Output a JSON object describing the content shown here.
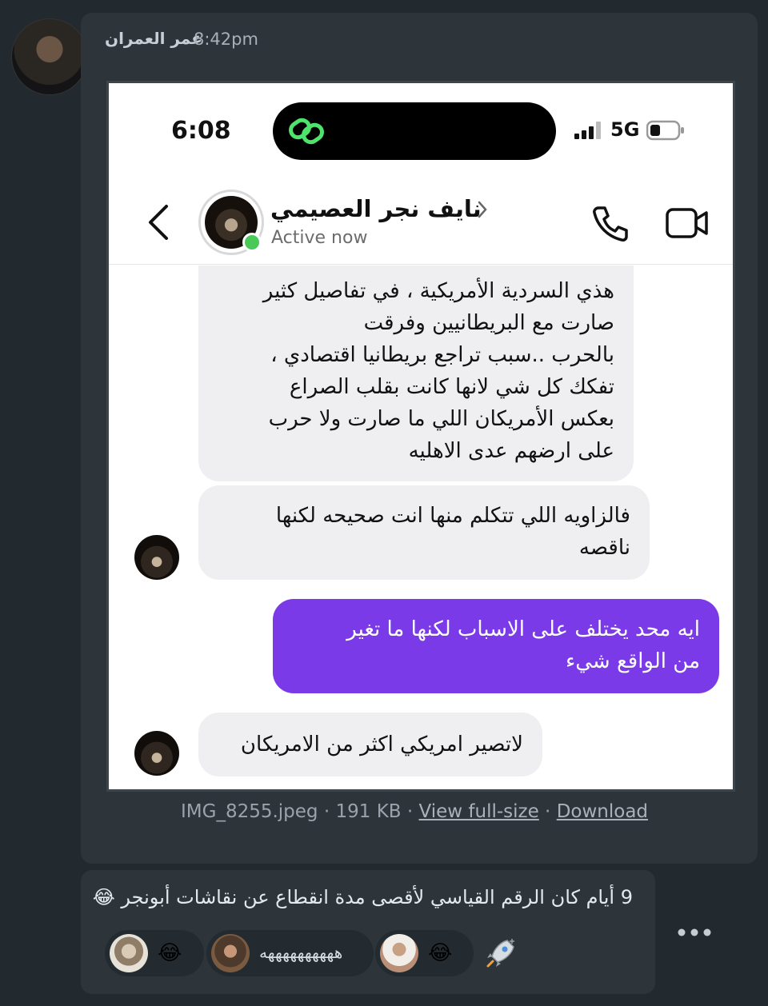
{
  "post": {
    "author": "عمر العمران",
    "time": "8:42pm"
  },
  "screenshot": {
    "status": {
      "time": "6:08",
      "network": "5G"
    },
    "contact": {
      "name": "نايف نجر العصيمي",
      "status": "Active now"
    },
    "messages": [
      {
        "direction": "in",
        "text": "هذي السردية الأمريكية ، في تفاصيل كثير\nصارت مع البريطانيين وفرقت\nبالحرب ..سبب تراجع بريطانيا اقتصادي ،\nتفكك كل شي لانها كانت بقلب الصراع\nبعكس الأمريكان اللي ما صارت ولا حرب\nعلى ارضهم عدى الاهليه"
      },
      {
        "direction": "in",
        "text": "فالزاويه اللي تتكلم منها انت صحيحه لكنها\nناقصه"
      },
      {
        "direction": "out",
        "text": "ايه محد يختلف على الاسباب لكنها ما تغير\nمن الواقع شيء"
      },
      {
        "direction": "in",
        "text": "لاتصير امريكي اكثر من الامريكان"
      }
    ]
  },
  "attachment": {
    "filename": "IMG_8255.jpeg",
    "size": "191 KB",
    "view_label": "View full-size",
    "download_label": "Download",
    "sep": " · "
  },
  "reply": {
    "text": "9 أيام كان الرقم القياسي لأقصى مدة انقطاع عن نقاشات أبونجر 😂",
    "reactions": [
      {
        "emoji": "😂"
      },
      {
        "text": "ههههههههههه"
      },
      {
        "emoji": "😂"
      }
    ]
  },
  "icons": {
    "add_reaction": "rocket-icon",
    "more": "more-icon"
  },
  "colors": {
    "background": "#222a30",
    "card": "#2d353b",
    "outgoing_bubble": "#7b3ae8",
    "incoming_bubble": "#efeff2",
    "online": "#4ac959"
  }
}
